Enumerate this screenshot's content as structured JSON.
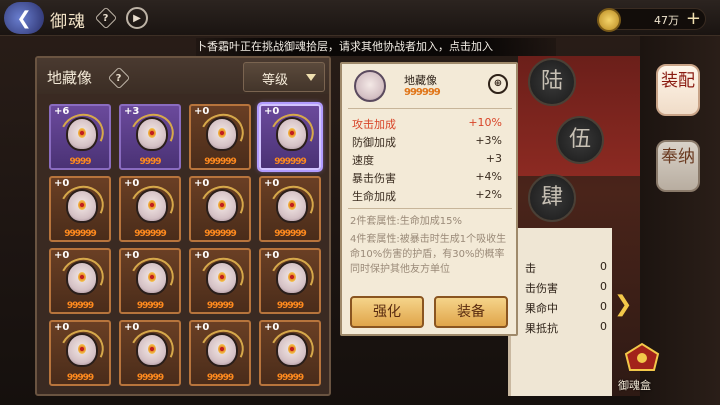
{
  "header": {
    "title": "御魂",
    "help_glyph": "?",
    "play_glyph": "▶",
    "back_glyph": "❮",
    "coins": "47万",
    "add_glyph": "+"
  },
  "marquee": "卜香霜叶正在挑战御魂拾层，请求其他协战者加入，点击加入",
  "panel": {
    "title": "地藏像",
    "help_glyph": "?",
    "sort_label": "等级"
  },
  "cards": [
    {
      "level": "+6",
      "stars": "9999",
      "style": "purple"
    },
    {
      "level": "+3",
      "stars": "9999",
      "style": "purple"
    },
    {
      "level": "+0",
      "stars": "999999",
      "style": "orange"
    },
    {
      "level": "+0",
      "stars": "999999",
      "style": "purple-selected"
    },
    {
      "level": "+0",
      "stars": "999999",
      "style": "orange"
    },
    {
      "level": "+0",
      "stars": "999999",
      "style": "orange"
    },
    {
      "level": "+0",
      "stars": "999999",
      "style": "orange"
    },
    {
      "level": "+0",
      "stars": "999999",
      "style": "orange"
    },
    {
      "level": "+0",
      "stars": "99999",
      "style": "orange"
    },
    {
      "level": "+0",
      "stars": "99999",
      "style": "orange"
    },
    {
      "level": "+0",
      "stars": "99999",
      "style": "orange"
    },
    {
      "level": "+0",
      "stars": "99999",
      "style": "orange"
    },
    {
      "level": "+0",
      "stars": "99999",
      "style": "orange"
    },
    {
      "level": "+0",
      "stars": "99999",
      "style": "orange"
    },
    {
      "level": "+0",
      "stars": "99999",
      "style": "orange"
    },
    {
      "level": "+0",
      "stars": "99999",
      "style": "orange"
    }
  ],
  "detail": {
    "name": "地藏像",
    "stars": "999999",
    "lock_glyph": "⊕",
    "main_stat": {
      "label": "攻击加成",
      "value": "+10%"
    },
    "sub_stats": [
      {
        "label": "防御加成",
        "value": "+3%"
      },
      {
        "label": "速度",
        "value": "+3"
      },
      {
        "label": "暴击伤害",
        "value": "+4%"
      },
      {
        "label": "生命加成",
        "value": "+2%"
      }
    ],
    "set2": "2件套属性:生命加成15%",
    "set4": "4件套属性:被暴击时生成1个吸收生命10%伤害的护盾，有30%的概率同时保护其他友方单位",
    "btn_enhance": "强化",
    "btn_equip": "装备"
  },
  "right_sheet": [
    {
      "label": "击",
      "value": "0"
    },
    {
      "label": "击伤害",
      "value": "0"
    },
    {
      "label": "果命中",
      "value": "0"
    },
    {
      "label": "果抵抗",
      "value": "0"
    }
  ],
  "slot_circles": [
    "陆",
    "伍",
    "肆"
  ],
  "side_tabs": {
    "equip": "装配",
    "offer": "奉纳"
  },
  "box_label": "御魂盒",
  "next_glyph": "❯"
}
